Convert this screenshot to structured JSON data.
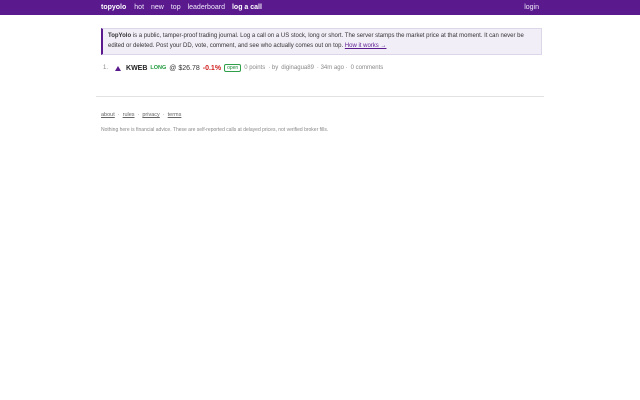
{
  "colors": {
    "brand": "#5a1a8e",
    "long": "#1f9a3c",
    "negative": "#d02020"
  },
  "nav": {
    "brand": "topyolo",
    "items": [
      "hot",
      "new",
      "top",
      "leaderboard"
    ],
    "cta": "log a call",
    "login": "login"
  },
  "intro": {
    "title": "TopYolo",
    "body": " is a public, tamper-proof trading journal. Log a call on a US stock, long or short. The server stamps the market price at that moment. It can never be edited or deleted. Post your DD, vote, comment, and see who actually comes out on top. ",
    "link": "How it works →"
  },
  "calls": [
    {
      "rank": "1.",
      "icon": "upvote-arrow-icon",
      "ticker": "KWEB",
      "direction": "LONG",
      "price": "@ $26.78",
      "change": "-0.1%",
      "status": "open",
      "points": "0 points",
      "by_prefix": "· by",
      "user": "diginagua89",
      "age": "· 34m ago ·",
      "comments": "0 comments"
    }
  ],
  "footer": {
    "links": [
      "about",
      "rules",
      "privacy",
      "terms"
    ],
    "separator": "·",
    "disclaimer": "Nothing here is financial advice. These are self-reported calls at delayed prices, not verified broker fills."
  }
}
